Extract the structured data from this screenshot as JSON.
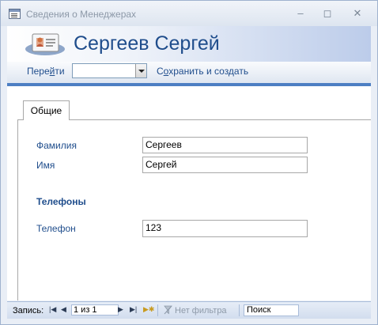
{
  "window": {
    "title": "Сведения о Менеджерах"
  },
  "header": {
    "title": "Сергеев Сергей"
  },
  "toolbar": {
    "goto_label_pre": "Пере",
    "goto_label_u": "й",
    "goto_label_post": "ти",
    "goto_value": "",
    "save_label_pre": "С",
    "save_label_u": "о",
    "save_label_post": "хранить и создать"
  },
  "tabs": [
    {
      "label": "Общие"
    }
  ],
  "form": {
    "last_name_label": "Фамилия",
    "last_name_value": "Сергеев",
    "first_name_label": "Имя",
    "first_name_value": "Сергей",
    "phones_heading": "Телефоны",
    "phone_label": "Телефон",
    "phone_value": "123"
  },
  "navbar": {
    "record_label": "Запись:",
    "position": "1 из 1",
    "filter_label": "Нет фильтра",
    "search_placeholder": "Поиск"
  },
  "icons": {
    "app": "form-icon",
    "header": "contact-card-icon",
    "nav_first": "first-record-icon",
    "nav_prev": "previous-record-icon",
    "nav_next": "next-record-icon",
    "nav_last": "last-record-icon",
    "nav_new": "new-record-icon",
    "filter": "no-filter-icon"
  },
  "colors": {
    "accent": "#1f4d8c",
    "header_gradient_end": "#bcccea",
    "divider": "#4d7fc3"
  }
}
